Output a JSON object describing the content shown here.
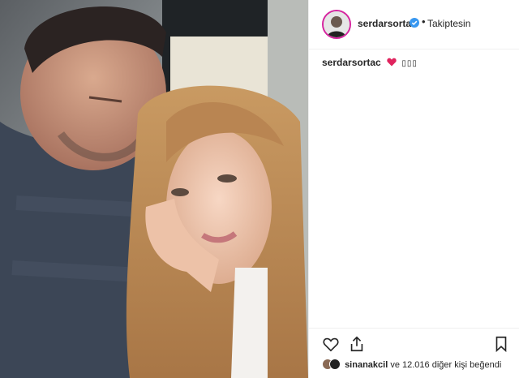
{
  "post": {
    "username": "serdarsortac",
    "follow_status": "Takiptesin",
    "follow_separator": "•",
    "caption_user": "serdarsortac",
    "caption_boxes": "▯▯▯",
    "liked_by_user": "sinanakcil",
    "liked_by_text": "ve 12.016 diğer kişi beğendi"
  },
  "colors": {
    "verified": "#3897f0",
    "avatar_ring": "#d6249f",
    "heart_emoji": "#e0245e"
  }
}
